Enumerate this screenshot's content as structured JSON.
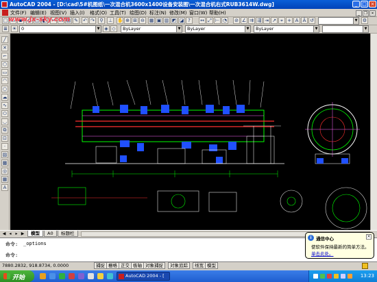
{
  "window": {
    "title": "AutoCAD 2004 - [D:\\cad\\5#机图纸\\一次混合机3600x1400设备安装图\\一次混合机右式RUB3614W.dwg]",
    "controls": [
      "_",
      "□",
      "×"
    ]
  },
  "menu": {
    "items": [
      "文件(F)",
      "编辑(E)",
      "视图(V)",
      "插入(I)",
      "格式(O)",
      "工具(T)",
      "绘图(D)",
      "标注(N)",
      "修改(M)",
      "窗口(W)",
      "帮助(H)"
    ]
  },
  "toolbar": {
    "layer_combo": "0",
    "linetype_combo": "ByLayer",
    "lineweight_combo": "ByLayer",
    "color_combo": "ByLayer",
    "style_combo": ""
  },
  "watermark": "www.jx-sky.com",
  "layout_tabs": [
    "模型",
    "A0",
    "标题栏"
  ],
  "command": {
    "line1_prompt": "命令:",
    "line1_text": "_options",
    "line2_prompt": "命令:"
  },
  "status": {
    "coords": "7880.2832, 918.8734, 0.0000",
    "toggles": [
      "捕捉",
      "栅格",
      "正交",
      "极轴",
      "对象捕捉",
      "对象追踪",
      "线宽",
      "模型"
    ]
  },
  "taskbar": {
    "start_label": "开始",
    "task_label": "AutoCAD 2004 - [",
    "clock": "13:23"
  },
  "balloon": {
    "title": "通信中心",
    "body": "使软件保持最新的简单方法。",
    "link": "单击此处。"
  },
  "colors": {
    "drawing_bg": "#000000",
    "title_blue": "#0a5fd8",
    "taskbar_blue": "#1f5ed0",
    "start_green": "#3aa52e",
    "balloon_bg": "#ffffe1"
  }
}
